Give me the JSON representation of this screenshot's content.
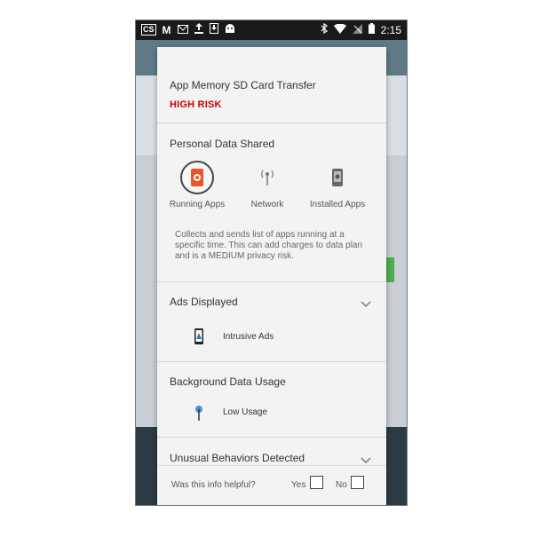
{
  "status_bar": {
    "left_icons": [
      "cs-icon",
      "m-icon",
      "mail-icon",
      "upload-icon",
      "download-icon",
      "android-icon"
    ],
    "right_icons": [
      "bluetooth-icon",
      "wifi-icon",
      "no-signal-icon",
      "battery-icon"
    ],
    "time": "2:15",
    "cs_label": "CS"
  },
  "dialog": {
    "app_name": "App Memory SD Card Transfer",
    "risk_level": "HIGH RISK",
    "risk_color": "#cc0000",
    "personal_data": {
      "title": "Personal Data Shared",
      "items": [
        {
          "label": "Running Apps",
          "icon": "running-apps-icon",
          "selected": true
        },
        {
          "label": "Network",
          "icon": "network-icon",
          "selected": false
        },
        {
          "label": "Installed Apps",
          "icon": "installed-apps-icon",
          "selected": false
        }
      ],
      "description": "Collects and sends list of apps running at a specific time. This can add charges to data plan and is a MEDIUM privacy risk."
    },
    "ads": {
      "title": "Ads Displayed",
      "item_label": "Intrusive Ads",
      "item_icon": "intrusive-ads-icon"
    },
    "background_data": {
      "title": "Background Data Usage",
      "item_label": "Low Usage",
      "item_icon": "low-usage-icon"
    },
    "unusual": {
      "title": "Unusual Behaviors Detected"
    },
    "footer": {
      "question": "Was this info helpful?",
      "yes_label": "Yes",
      "no_label": "No"
    }
  }
}
